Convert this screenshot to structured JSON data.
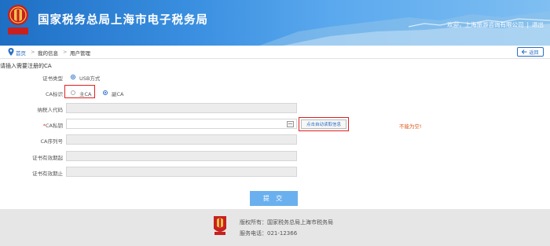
{
  "header": {
    "title": "国家税务总局上海市电子税务局",
    "welcome": "欢迎，上海旅游咨询有限公司",
    "separator": "|",
    "exit": "退出",
    "logo_text": "中国税务"
  },
  "breadcrumb": {
    "home": "首页",
    "sep": ">",
    "my_info": "我的信息",
    "user_mgmt": "用户管理",
    "back": "返回"
  },
  "form": {
    "notice": "请插入需要注册的CA",
    "cert_type_label": "证书类型",
    "cert_type_option": "USB方式",
    "ca_id_label": "CA标识",
    "ca_main": "主CA",
    "ca_sub": "副CA",
    "taxpayer_code_label": "纳税人代码",
    "ca_password_req": "*",
    "ca_password_label": "CA私钥",
    "read_button": "点击自动读取信息",
    "error_text": "不能为空!",
    "ca_serial_label": "CA序列号",
    "valid_from_label": "证书有效期起",
    "valid_to_label": "证书有效期止",
    "submit": "提 交"
  },
  "footer": {
    "copyright": "版权所有：国家税务总局上海市税务局",
    "phone": "服务电话：021-12366"
  },
  "colors": {
    "header_blue": "#1e6fc4",
    "link_blue": "#2a6fc4",
    "submit_blue": "#6ab0ee",
    "highlight_red": "#e02020",
    "error_orange": "#e05a1a",
    "footer_gray": "#e6e6e6"
  }
}
